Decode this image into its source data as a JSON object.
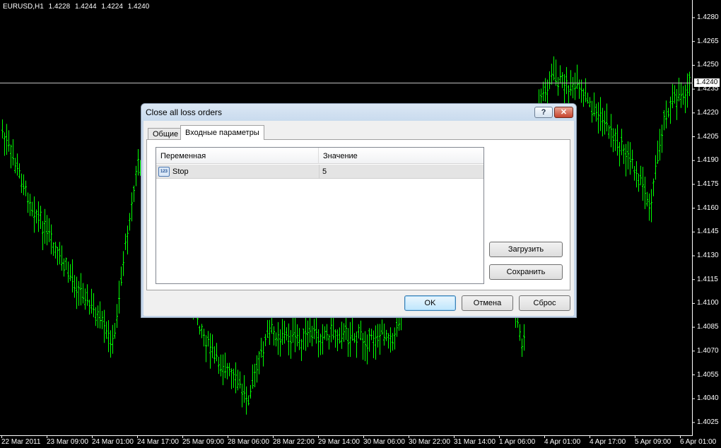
{
  "chart": {
    "symbol": "EURUSD,H1",
    "ohlc": [
      "1.4228",
      "1.4244",
      "1.4224",
      "1.4240"
    ],
    "bid_price": "1.4240",
    "colors": {
      "background": "#000000",
      "bars": "#00ff00",
      "text": "#ffffff",
      "bid_line": "#c0c0c0"
    },
    "price_ticks": [
      "1.4280",
      "1.4265",
      "1.4250",
      "1.4235",
      "1.4220",
      "1.4205",
      "1.4190",
      "1.4175",
      "1.4160",
      "1.4145",
      "1.4130",
      "1.4115",
      "1.4100",
      "1.4085",
      "1.4070",
      "1.4055",
      "1.4040",
      "1.4025"
    ],
    "time_ticks": [
      "22 Mar 2011",
      "23 Mar 09:00",
      "24 Mar 01:00",
      "24 Mar 17:00",
      "25 Mar 09:00",
      "28 Mar 06:00",
      "28 Mar 22:00",
      "29 Mar 14:00",
      "30 Mar 06:00",
      "30 Mar 22:00",
      "31 Mar 14:00",
      "1 Apr 06:00",
      "4 Apr 01:00",
      "4 Apr 17:00",
      "5 Apr 09:00",
      "6 Apr 01:00"
    ]
  },
  "dialog": {
    "title": "Close all loss orders",
    "help_label": "?",
    "close_label": "✕",
    "tabs": [
      {
        "label": "Общие",
        "active": false
      },
      {
        "label": "Входные параметры",
        "active": true
      }
    ],
    "grid": {
      "columns": [
        "Переменная",
        "Значение"
      ],
      "rows": [
        {
          "icon": "integer-param-icon",
          "icon_text": "123",
          "variable": "Stop",
          "value": "5"
        }
      ]
    },
    "side_buttons": {
      "load": "Загрузить",
      "save": "Сохранить"
    },
    "footer_buttons": {
      "ok": "OK",
      "cancel": "Отмена",
      "reset": "Сброс"
    }
  }
}
